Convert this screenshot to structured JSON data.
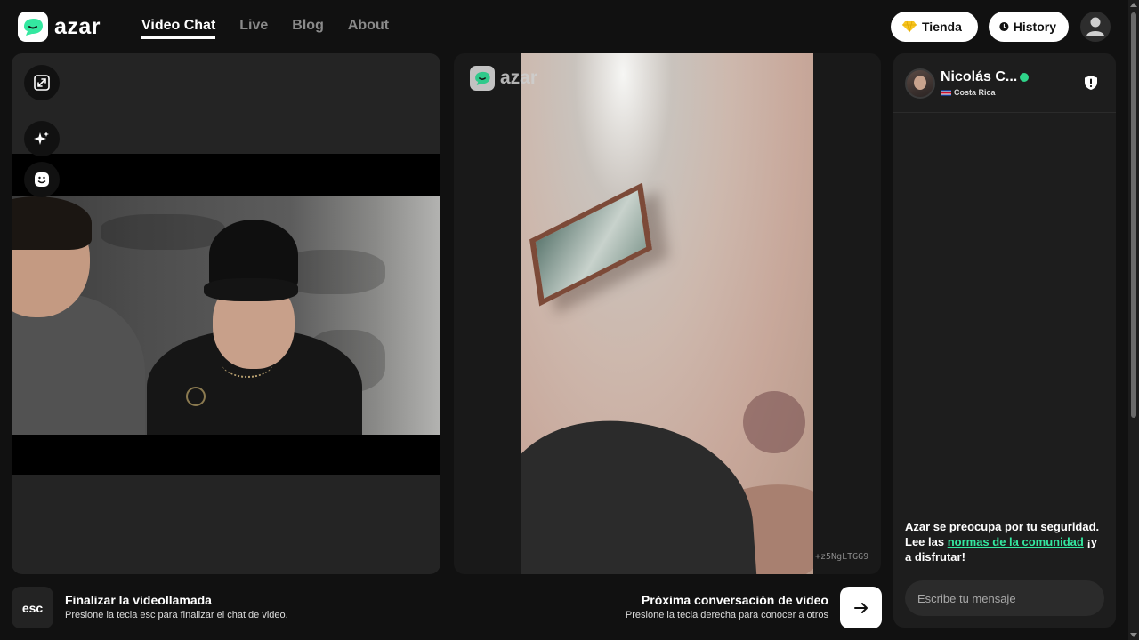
{
  "brand": {
    "name": "azar",
    "accent": "#34e8a0"
  },
  "nav": {
    "items": [
      {
        "label": "Video Chat",
        "active": true
      },
      {
        "label": "Live",
        "active": false
      },
      {
        "label": "Blog",
        "active": false
      },
      {
        "label": "About",
        "active": false
      }
    ]
  },
  "header": {
    "store_label": "Tienda",
    "store_icon": "gem-icon",
    "history_label": "History",
    "history_icon": "clock-icon",
    "profile_icon": "user-icon"
  },
  "left_panel": {
    "buttons": [
      {
        "icon": "expand-icon"
      },
      {
        "icon": "sparkle-effects-icon"
      },
      {
        "icon": "face-mask-icon"
      }
    ]
  },
  "remote_video": {
    "watermark": "azar",
    "video_id": "+z5NgLTGG9"
  },
  "chat": {
    "peer_name": "Nicolás C...",
    "peer_country": "Costa Rica",
    "safety_pre": "Azar se preocupa por tu seguridad. Lee las ",
    "safety_link": "normas de la comunidad",
    "safety_post": " ¡y a disfrutar!",
    "input_placeholder": "Escribe tu mensaje"
  },
  "bottom": {
    "esc_key": "esc",
    "end_title": "Finalizar la videollamada",
    "end_subtitle": "Presione la tecla esc para finalizar el chat de video.",
    "next_title": "Próxima conversación de video",
    "next_subtitle": "Presione la tecla derecha para conocer a otros"
  }
}
